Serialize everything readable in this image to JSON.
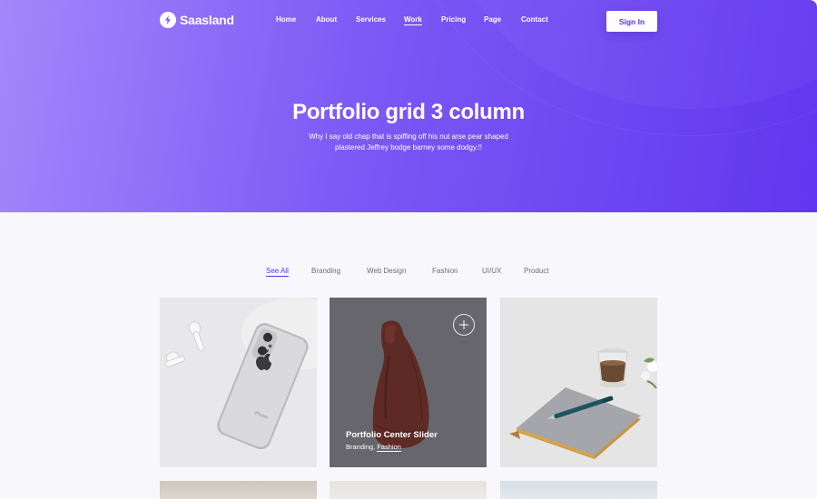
{
  "brand": {
    "name": "Saasland"
  },
  "nav": {
    "items": [
      "Home",
      "About",
      "Services",
      "Work",
      "Pricing",
      "Page",
      "Contact"
    ],
    "active": "Work"
  },
  "header": {
    "signin_label": "Sign In"
  },
  "hero": {
    "title": "Portfolio grid 3 column",
    "subtitle_line1": "Why I say old chap that is spiffing off his nut arse pear shaped",
    "subtitle_line2": "plastered Jeffrey bodge barney some dodgy.!!"
  },
  "filters": {
    "items": [
      "See All",
      "Branding",
      "Web Design",
      "Fashion",
      "UI/UX",
      "Product"
    ],
    "active": "See All"
  },
  "portfolio": {
    "hover_item": {
      "title": "Portfolio Center Slider",
      "tag1": "Branding,",
      "tag2": "Fashion"
    }
  },
  "colors": {
    "accent": "#5d2ff0",
    "hero_start": "#a487fb",
    "hero_end": "#6236ef",
    "page_bg": "#f8f8fc"
  },
  "icons": [
    "lightning-logo-icon",
    "plus-circle-icon",
    "apple-logo-icon"
  ]
}
